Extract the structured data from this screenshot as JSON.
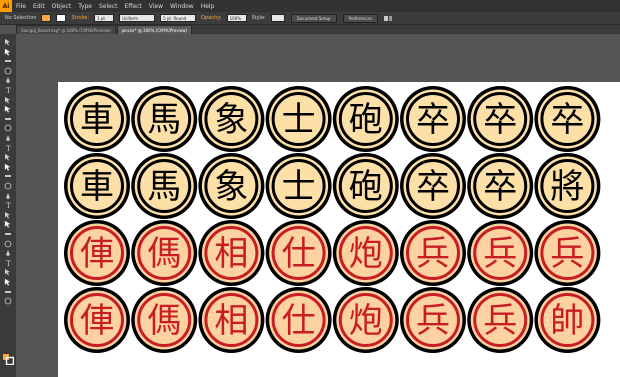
{
  "app": {
    "logo": "Ai"
  },
  "menus": [
    "File",
    "Edit",
    "Object",
    "Type",
    "Select",
    "Effect",
    "View",
    "Window",
    "Help"
  ],
  "control": {
    "selection_label": "No Selection",
    "stroke_label": "Stroke:",
    "stroke_value": "1 pt",
    "uniform_label": "Uniform",
    "brush_value": "5 pt. Round",
    "opacity_label": "Opacity:",
    "opacity_value": "100%",
    "style_label": "Style:",
    "doc_setup_btn": "Document Setup",
    "prefs_btn": "Preferences"
  },
  "tabs": [
    {
      "label": "Xiangqi_Board.svg* @ 100% (CMYK/Preview)",
      "active": false
    },
    {
      "label": "pieces* @ 300% (CMYK/Preview)",
      "active": true
    }
  ],
  "icons": [
    "selection-tool-icon",
    "direct-selection-tool-icon",
    "magic-wand-tool-icon",
    "lasso-tool-icon",
    "pen-tool-icon",
    "type-tool-icon",
    "line-tool-icon",
    "rectangle-tool-icon",
    "paintbrush-tool-icon",
    "pencil-tool-icon",
    "blob-brush-tool-icon",
    "eraser-tool-icon",
    "rotate-tool-icon",
    "scale-tool-icon",
    "width-tool-icon",
    "free-transform-tool-icon",
    "shape-builder-tool-icon",
    "perspective-grid-tool-icon",
    "mesh-tool-icon",
    "gradient-tool-icon",
    "eyedropper-tool-icon",
    "blend-tool-icon",
    "symbol-sprayer-tool-icon",
    "column-graph-tool-icon",
    "artboard-tool-icon",
    "slice-tool-icon",
    "hand-tool-icon",
    "zoom-tool-icon"
  ],
  "colors": {
    "black_fill": "#fde0a8",
    "black_ink": "#000000",
    "red_fill": "#fcd3a0",
    "red_ink": "#c91d24",
    "rim": "#000000",
    "toolbar_swatch": "#f3a844"
  },
  "pieces": {
    "rows": [
      {
        "side": "black",
        "chars": [
          "車",
          "馬",
          "象",
          "士",
          "砲",
          "卒",
          "卒",
          "卒"
        ]
      },
      {
        "side": "black",
        "chars": [
          "車",
          "馬",
          "象",
          "士",
          "砲",
          "卒",
          "卒",
          "將"
        ]
      },
      {
        "side": "red",
        "chars": [
          "俥",
          "傌",
          "相",
          "仕",
          "炮",
          "兵",
          "兵",
          "兵"
        ]
      },
      {
        "side": "red",
        "chars": [
          "俥",
          "傌",
          "相",
          "仕",
          "炮",
          "兵",
          "兵",
          "帥"
        ]
      }
    ]
  }
}
